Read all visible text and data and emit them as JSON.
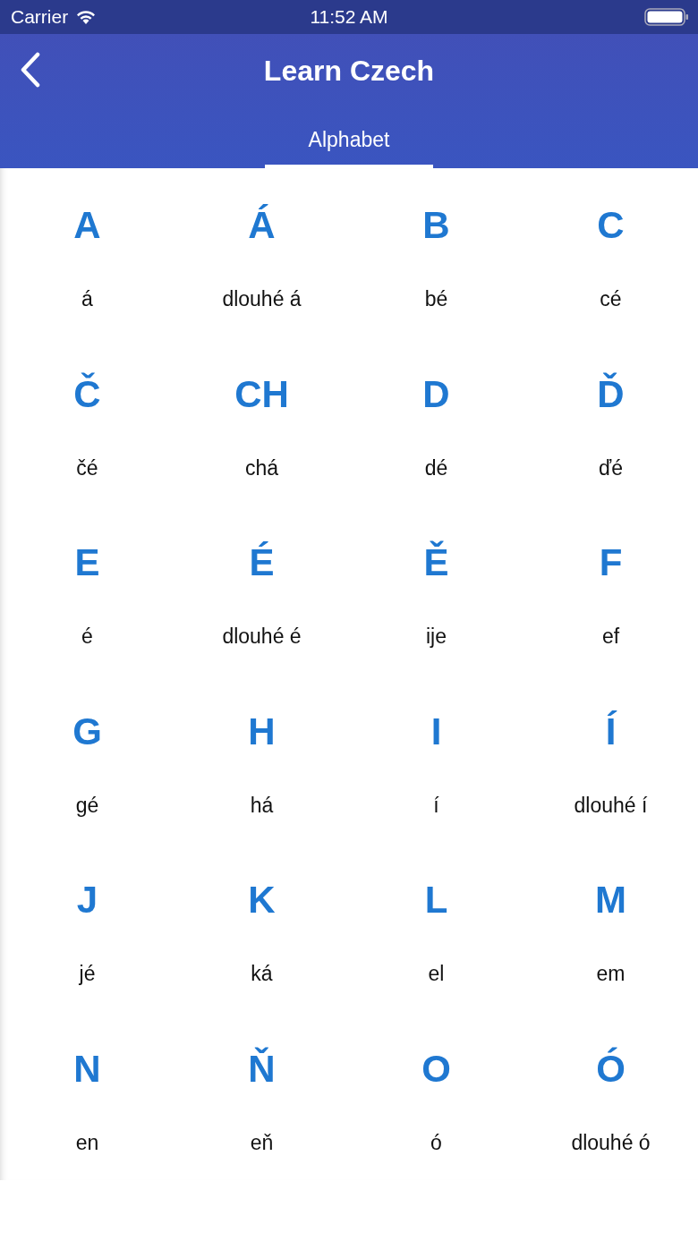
{
  "status_bar": {
    "carrier": "Carrier",
    "time": "11:52 AM"
  },
  "nav": {
    "title": "Learn Czech"
  },
  "tabs": [
    {
      "label": "Alphabet",
      "selected": true
    }
  ],
  "letters": [
    {
      "letter": "A",
      "name": "á"
    },
    {
      "letter": "Á",
      "name": "dlouhé á"
    },
    {
      "letter": "B",
      "name": "bé"
    },
    {
      "letter": "C",
      "name": "cé"
    },
    {
      "letter": "Č",
      "name": "čé"
    },
    {
      "letter": "CH",
      "name": "chá"
    },
    {
      "letter": "D",
      "name": "dé"
    },
    {
      "letter": "Ď",
      "name": "ďé"
    },
    {
      "letter": "E",
      "name": "é"
    },
    {
      "letter": "É",
      "name": "dlouhé é"
    },
    {
      "letter": "Ě",
      "name": "ije"
    },
    {
      "letter": "F",
      "name": "ef"
    },
    {
      "letter": "G",
      "name": "gé"
    },
    {
      "letter": "H",
      "name": "há"
    },
    {
      "letter": "I",
      "name": "í"
    },
    {
      "letter": "Í",
      "name": "dlouhé í"
    },
    {
      "letter": "J",
      "name": "jé"
    },
    {
      "letter": "K",
      "name": "ká"
    },
    {
      "letter": "L",
      "name": "el"
    },
    {
      "letter": "M",
      "name": "em"
    },
    {
      "letter": "N",
      "name": "en"
    },
    {
      "letter": "Ň",
      "name": "eň"
    },
    {
      "letter": "O",
      "name": "ó"
    },
    {
      "letter": "Ó",
      "name": "dlouhé ó"
    }
  ]
}
